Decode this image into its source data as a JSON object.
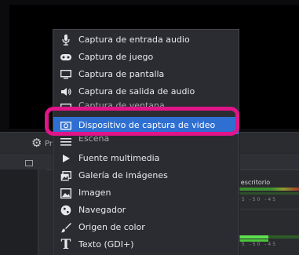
{
  "toolbar": {
    "settings_icon": "gear-icon"
  },
  "context_menu": {
    "items": [
      {
        "label": "Captura de entrada audio",
        "icon": "microphone-icon"
      },
      {
        "label": "Captura de juego",
        "icon": "gamepad-icon"
      },
      {
        "label": "Captura de pantalla",
        "icon": "monitor-icon"
      },
      {
        "label": "Captura de salida de audio",
        "icon": "speaker-icon"
      },
      {
        "label": "Captura de ventana",
        "icon": "window-icon"
      },
      {
        "label": "Dispositivo de captura de video",
        "icon": "camera-icon",
        "selected": true
      },
      {
        "label": "Escena",
        "icon": "scene-list-icon"
      },
      {
        "label": "Fuente multimedia",
        "icon": "play-icon"
      },
      {
        "label": "Galería de imágenes",
        "icon": "gallery-icon"
      },
      {
        "label": "Imagen",
        "icon": "image-icon"
      },
      {
        "label": "Navegador",
        "icon": "globe-icon"
      },
      {
        "label": "Origen de color",
        "icon": "paint-brush-icon"
      },
      {
        "label": "Texto (GDI+)",
        "icon": "text-icon"
      }
    ]
  },
  "audio_mixer": {
    "source_label": "l escritorio",
    "meter_ticks": "55  -50  -45"
  },
  "colors": {
    "selection": "#2f6fd1",
    "highlight_outline": "#e0158a",
    "menu_bg": "#2b2c31"
  }
}
